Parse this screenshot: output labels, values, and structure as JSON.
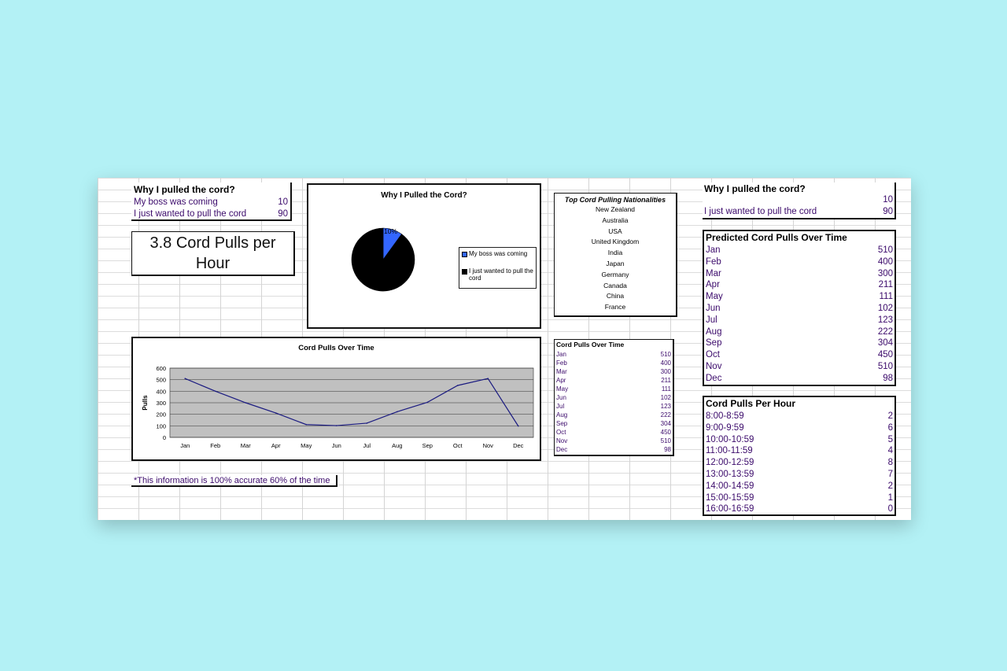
{
  "why_box": {
    "title": "Why I pulled the cord?",
    "rows": [
      {
        "label": "My boss was coming",
        "value": "10"
      },
      {
        "label": "I just wanted to pull the cord",
        "value": "90"
      }
    ]
  },
  "big_stat": {
    "line1": "3.8 Cord Pulls per",
    "line2": "Hour"
  },
  "pie_chart": {
    "title": "Why I Pulled the Cord?",
    "pct_label": "10%",
    "legend": [
      {
        "label": "My boss was coming",
        "color": "#3366ff"
      },
      {
        "label": "I just wanted to pull the cord",
        "color": "#000000"
      }
    ]
  },
  "nationalities": {
    "title": "Top Cord Pulling Nationalities",
    "items": [
      "New Zealand",
      "Australia",
      "USA",
      "United Kingdom",
      "India",
      "Japan",
      "Germany",
      "Canada",
      "China",
      "France"
    ]
  },
  "small_table": {
    "title": "Cord Pulls Over Time",
    "rows": [
      {
        "month": "Jan",
        "value": "510"
      },
      {
        "month": "Feb",
        "value": "400"
      },
      {
        "month": "Mar",
        "value": "300"
      },
      {
        "month": "Apr",
        "value": "211"
      },
      {
        "month": "May",
        "value": "111"
      },
      {
        "month": "Jun",
        "value": "102"
      },
      {
        "month": "Jul",
        "value": "123"
      },
      {
        "month": "Aug",
        "value": "222"
      },
      {
        "month": "Sep",
        "value": "304"
      },
      {
        "month": "Oct",
        "value": "450"
      },
      {
        "month": "Nov",
        "value": "510"
      },
      {
        "month": "Dec",
        "value": "98"
      }
    ]
  },
  "footnote": "*This information is 100% accurate 60% of the time",
  "why_box_right": {
    "title": "Why I pulled the cord?",
    "rows": [
      {
        "label": "",
        "value": "10"
      },
      {
        "label": "I just wanted to pull the cord",
        "value": "90"
      }
    ]
  },
  "predicted": {
    "title": "Predicted Cord Pulls Over Time",
    "rows": [
      {
        "month": "Jan",
        "value": "510"
      },
      {
        "month": "Feb",
        "value": "400"
      },
      {
        "month": "Mar",
        "value": "300"
      },
      {
        "month": "Apr",
        "value": "211"
      },
      {
        "month": "May",
        "value": "111"
      },
      {
        "month": "Jun",
        "value": "102"
      },
      {
        "month": "Jul",
        "value": "123"
      },
      {
        "month": "Aug",
        "value": "222"
      },
      {
        "month": "Sep",
        "value": "304"
      },
      {
        "month": "Oct",
        "value": "450"
      },
      {
        "month": "Nov",
        "value": "510"
      },
      {
        "month": "Dec",
        "value": "98"
      }
    ]
  },
  "per_hour": {
    "title": "Cord Pulls Per Hour",
    "rows": [
      {
        "slot": "8:00-8:59",
        "value": "2"
      },
      {
        "slot": "9:00-9:59",
        "value": "6"
      },
      {
        "slot": "10:00-10:59",
        "value": "5"
      },
      {
        "slot": "11:00-11:59",
        "value": "4"
      },
      {
        "slot": "12:00-12:59",
        "value": "8"
      },
      {
        "slot": "13:00-13:59",
        "value": "7"
      },
      {
        "slot": "14:00-14:59",
        "value": "2"
      },
      {
        "slot": "15:00-15:59",
        "value": "1"
      },
      {
        "slot": "16:00-16:59",
        "value": "0"
      }
    ]
  },
  "chart_data": [
    {
      "type": "pie",
      "title": "Why I Pulled the Cord?",
      "categories": [
        "My boss was coming",
        "I just wanted to pull the cord"
      ],
      "values": [
        10,
        90
      ],
      "colors": [
        "#3366ff",
        "#000000"
      ],
      "data_labels": [
        "10%",
        ""
      ],
      "legend": "right"
    },
    {
      "type": "line",
      "title": "Cord Pulls Over Time",
      "xlabel": "",
      "ylabel": "Pulls",
      "categories": [
        "Jan",
        "Feb",
        "Mar",
        "Apr",
        "May",
        "Jun",
        "Jul",
        "Aug",
        "Sep",
        "Oct",
        "Nov",
        "Dec"
      ],
      "values": [
        510,
        400,
        300,
        211,
        111,
        102,
        123,
        222,
        304,
        450,
        510,
        98
      ],
      "ylim": [
        0,
        600
      ],
      "yticks": [
        0,
        100,
        200,
        300,
        400,
        500,
        600
      ],
      "grid": true,
      "line_color": "#1a1a80",
      "plot_background": "#c0c0c0"
    }
  ]
}
